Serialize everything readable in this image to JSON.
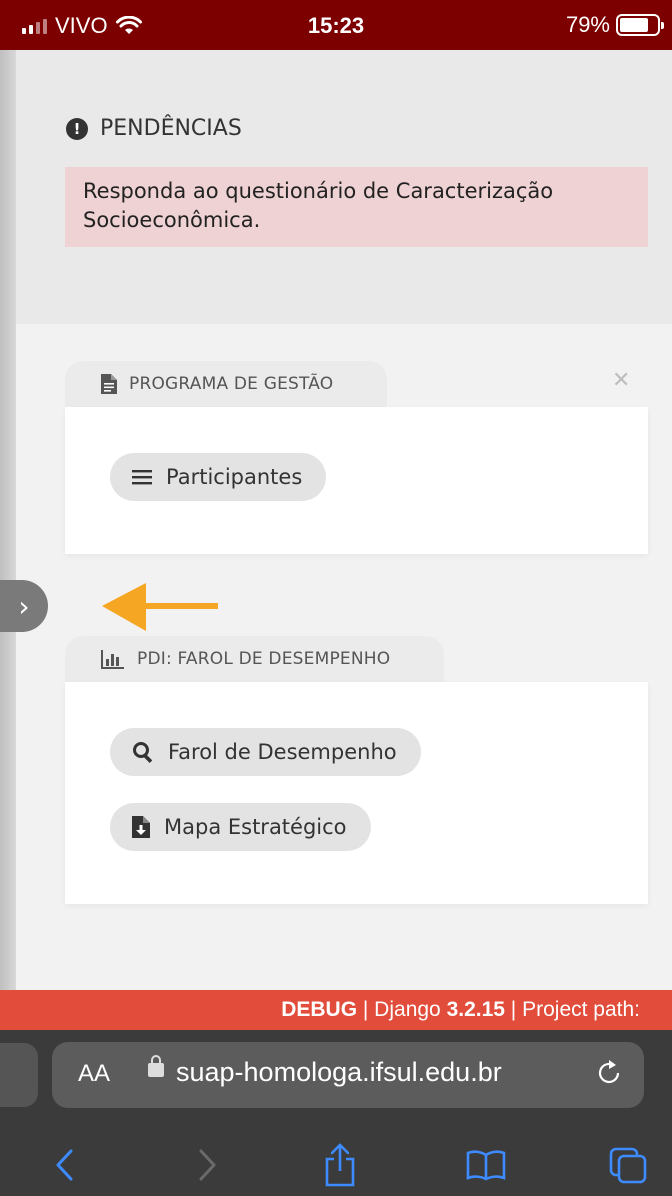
{
  "status_bar": {
    "carrier": "VIVO",
    "time": "15:23",
    "battery": "79%"
  },
  "pendencias": {
    "title": "PENDÊNCIAS",
    "alert_text": "Responda ao questionário de Caracterização Socioeconômica."
  },
  "cards": [
    {
      "title": "PROGRAMA DE GESTÃO",
      "icon": "file-icon",
      "buttons": [
        {
          "label": "Participantes",
          "icon": "list-icon"
        }
      ]
    },
    {
      "title": "PDI: FAROL DE DESEMPENHO",
      "icon": "bar-chart-icon",
      "buttons": [
        {
          "label": "Farol de Desempenho",
          "icon": "search-icon"
        },
        {
          "label": "Mapa Estratégico",
          "icon": "file-download-icon"
        }
      ]
    }
  ],
  "debug_bar": {
    "label": "DEBUG",
    "sep1": " | Django ",
    "version": "3.2.15",
    "sep2": " | Project path:"
  },
  "browser": {
    "text_size_label": "AA",
    "url": "suap-homologa.ifsul.edu.br"
  },
  "colors": {
    "status_bar": "#7d0000",
    "alert_bg": "#efd2d3",
    "debug_bar": "#e14c3b",
    "arrow": "#f5a623",
    "browser_chrome": "#3b3b3b"
  }
}
